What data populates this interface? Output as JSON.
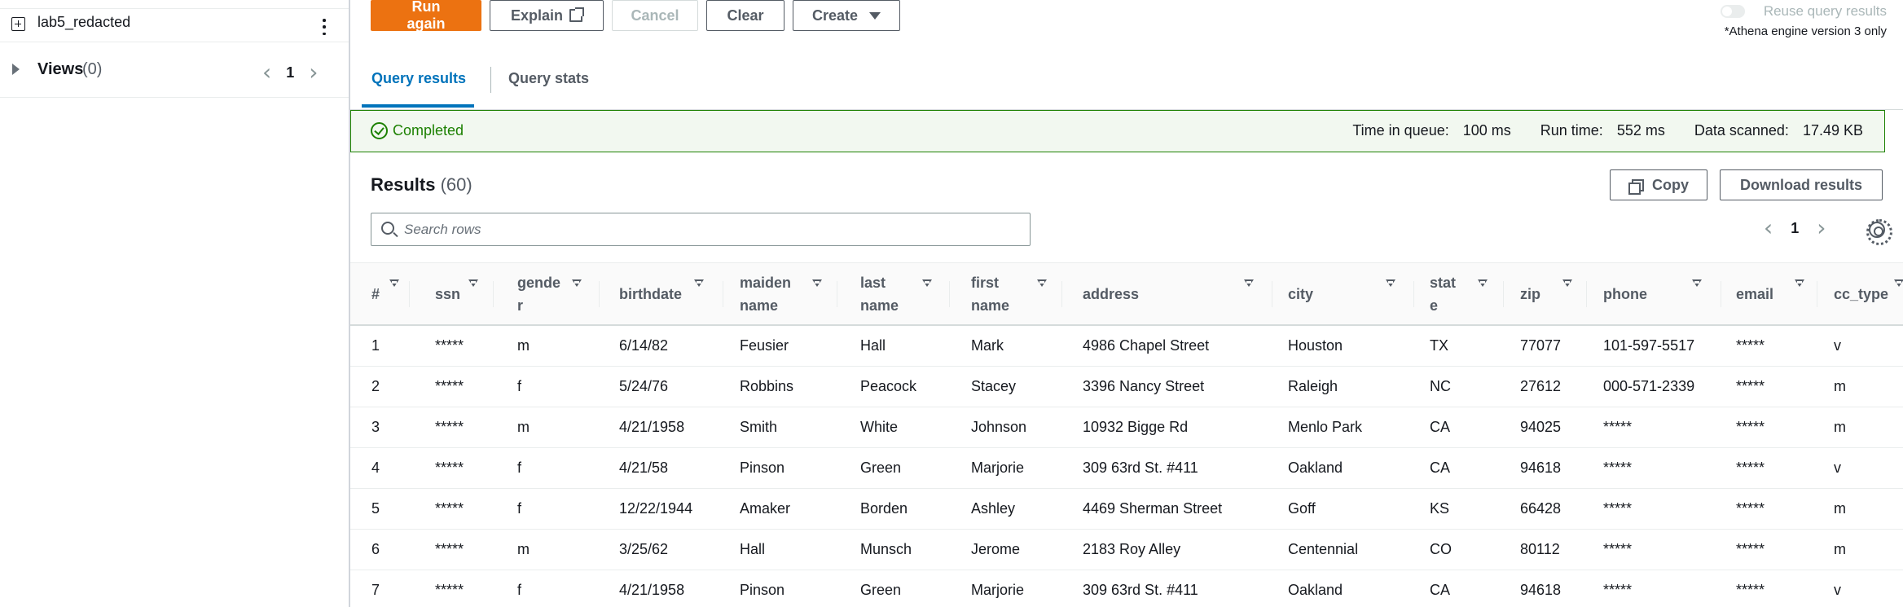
{
  "sidebar": {
    "database_label": "lab5_redacted",
    "views_label": "Views",
    "views_count": "(0)",
    "page": "1"
  },
  "toolbar": {
    "run_again": "Run again",
    "explain": "Explain",
    "cancel": "Cancel",
    "clear": "Clear",
    "create": "Create",
    "reuse_label": "Reuse query results",
    "reuse_note": "*Athena engine version 3 only"
  },
  "tabs": {
    "query_results": "Query results",
    "query_stats": "Query stats"
  },
  "status": {
    "text": "Completed",
    "time_in_queue_label": "Time in queue:",
    "time_in_queue": "100 ms",
    "run_time_label": "Run time:",
    "run_time": "552 ms",
    "data_scanned_label": "Data scanned:",
    "data_scanned": "17.49 KB"
  },
  "results": {
    "title": "Results",
    "count": "(60)",
    "copy": "Copy",
    "download": "Download results",
    "search_placeholder": "Search rows",
    "page": "1"
  },
  "table": {
    "columns": [
      "#",
      "ssn",
      "gende\nr",
      "birthdate",
      "maiden\nname",
      "last\nname",
      "first\nname",
      "address",
      "city",
      "stat\ne",
      "zip",
      "phone",
      "email",
      "cc_type"
    ],
    "rows": [
      [
        "1",
        "*****",
        "m",
        "6/14/82",
        "Feusier",
        "Hall",
        "Mark",
        "4986 Chapel Street",
        "Houston",
        "TX",
        "77077",
        "101-597-5517",
        "*****",
        "v"
      ],
      [
        "2",
        "*****",
        "f",
        "5/24/76",
        "Robbins",
        "Peacock",
        "Stacey",
        "3396 Nancy Street",
        "Raleigh",
        "NC",
        "27612",
        "000-571-2339",
        "*****",
        "m"
      ],
      [
        "3",
        "*****",
        "m",
        "4/21/1958",
        "Smith",
        "White",
        "Johnson",
        "10932 Bigge Rd",
        "Menlo Park",
        "CA",
        "94025",
        "*****",
        "*****",
        "m"
      ],
      [
        "4",
        "*****",
        "f",
        "4/21/58",
        "Pinson",
        "Green",
        "Marjorie",
        "309 63rd St. #411",
        "Oakland",
        "CA",
        "94618",
        "*****",
        "*****",
        "v"
      ],
      [
        "5",
        "*****",
        "f",
        "12/22/1944",
        "Amaker",
        "Borden",
        "Ashley",
        "4469 Sherman Street",
        "Goff",
        "KS",
        "66428",
        "*****",
        "*****",
        "m"
      ],
      [
        "6",
        "*****",
        "m",
        "3/25/62",
        "Hall",
        "Munsch",
        "Jerome",
        "2183 Roy Alley",
        "Centennial",
        "CO",
        "80112",
        "*****",
        "*****",
        "m"
      ],
      [
        "7",
        "*****",
        "f",
        "4/21/1958",
        "Pinson",
        "Green",
        "Marjorie",
        "309 63rd St. #411",
        "Oakland",
        "CA",
        "94618",
        "*****",
        "*****",
        "v"
      ]
    ]
  },
  "colors": {
    "primary": "#ec7211",
    "link": "#0073bb",
    "success": "#1d8102"
  }
}
